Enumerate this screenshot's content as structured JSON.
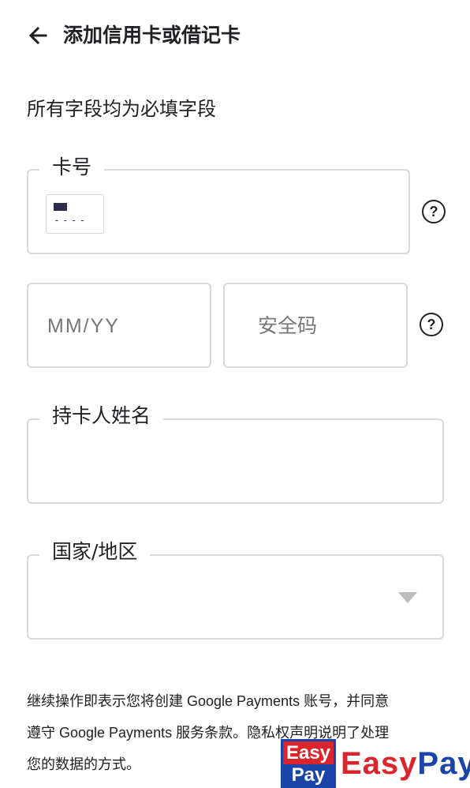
{
  "header": {
    "back_icon": "arrow-left-icon",
    "title": "添加信用卡或借记卡"
  },
  "form": {
    "required_note": "所有字段均为必填字段",
    "card_number": {
      "label": "卡号",
      "value": "",
      "icon": "credit-card-icon",
      "help_icon": "help-icon"
    },
    "expiry": {
      "placeholder": "MM/YY",
      "value": ""
    },
    "cvv": {
      "placeholder": "安全码",
      "value": "",
      "help_icon": "help-icon"
    },
    "cardholder_name": {
      "label": "持卡人姓名",
      "value": ""
    },
    "country": {
      "label": "国家/地区",
      "value": "",
      "arrow_icon": "dropdown-arrow-icon"
    }
  },
  "terms": {
    "line1": "继续操作即表示您将创建 Google Payments 账号，并同意",
    "line2": "遵守 Google Payments 服务条款。隐私权声明说明了处理",
    "line3": "您的数据的方式。"
  },
  "watermark": {
    "logo_top": "Easy",
    "logo_bottom": "Pay",
    "text_easy": "Easy",
    "text_pay": "Pay",
    "colors": {
      "red": "#d9252b",
      "blue": "#1a45a8"
    }
  }
}
